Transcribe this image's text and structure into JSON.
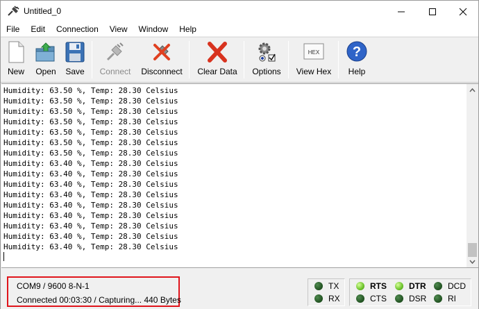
{
  "window": {
    "title": "Untitled_0"
  },
  "menu": [
    "File",
    "Edit",
    "Connection",
    "View",
    "Window",
    "Help"
  ],
  "toolbar": {
    "new": "New",
    "open": "Open",
    "save": "Save",
    "connect": "Connect",
    "disconnect": "Disconnect",
    "clear": "Clear Data",
    "options": "Options",
    "viewhex": "View Hex",
    "hex_icon_text": "HEX",
    "help": "Help"
  },
  "terminal": {
    "lines": [
      "Humidity: 63.50 %, Temp: 28.30 Celsius",
      "Humidity: 63.50 %, Temp: 28.30 Celsius",
      "Humidity: 63.50 %, Temp: 28.30 Celsius",
      "Humidity: 63.50 %, Temp: 28.30 Celsius",
      "Humidity: 63.50 %, Temp: 28.30 Celsius",
      "Humidity: 63.50 %, Temp: 28.30 Celsius",
      "Humidity: 63.50 %, Temp: 28.30 Celsius",
      "Humidity: 63.40 %, Temp: 28.30 Celsius",
      "Humidity: 63.40 %, Temp: 28.30 Celsius",
      "Humidity: 63.40 %, Temp: 28.30 Celsius",
      "Humidity: 63.40 %, Temp: 28.30 Celsius",
      "Humidity: 63.40 %, Temp: 28.30 Celsius",
      "Humidity: 63.40 %, Temp: 28.30 Celsius",
      "Humidity: 63.40 %, Temp: 28.30 Celsius",
      "Humidity: 63.40 %, Temp: 28.30 Celsius",
      "Humidity: 63.40 %, Temp: 28.30 Celsius"
    ]
  },
  "status": {
    "port": "COM9 / 9600 8-N-1",
    "connection": "Connected 00:03:30 / Capturing... 440 Bytes"
  },
  "signals": {
    "tx": "TX",
    "rx": "RX",
    "rts": "RTS",
    "cts": "CTS",
    "dtr": "DTR",
    "dsr": "DSR",
    "dcd": "DCD",
    "ri": "RI"
  },
  "colors": {
    "highlight_border": "#e0141b",
    "led_lit": "#6cc22b",
    "led_dark": "#1f4f1f"
  }
}
